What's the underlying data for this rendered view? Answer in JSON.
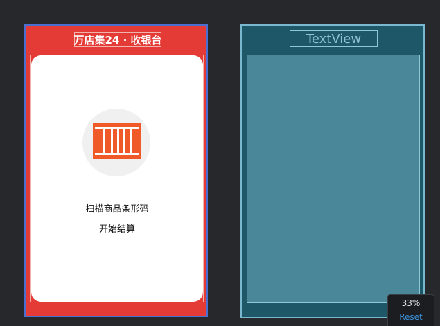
{
  "design": {
    "title": "万店集24 · 收银台",
    "scan_hint": "扫描商品条形码",
    "scan_subhint": "开始结算",
    "scan_icon": "barcode-icon",
    "colors": {
      "header": "#e43b36",
      "icon": "#f05a28",
      "card": "#ffffff"
    }
  },
  "blueprint": {
    "title": "TextView"
  },
  "zoom": {
    "level": "33%",
    "reset_label": "Reset"
  }
}
